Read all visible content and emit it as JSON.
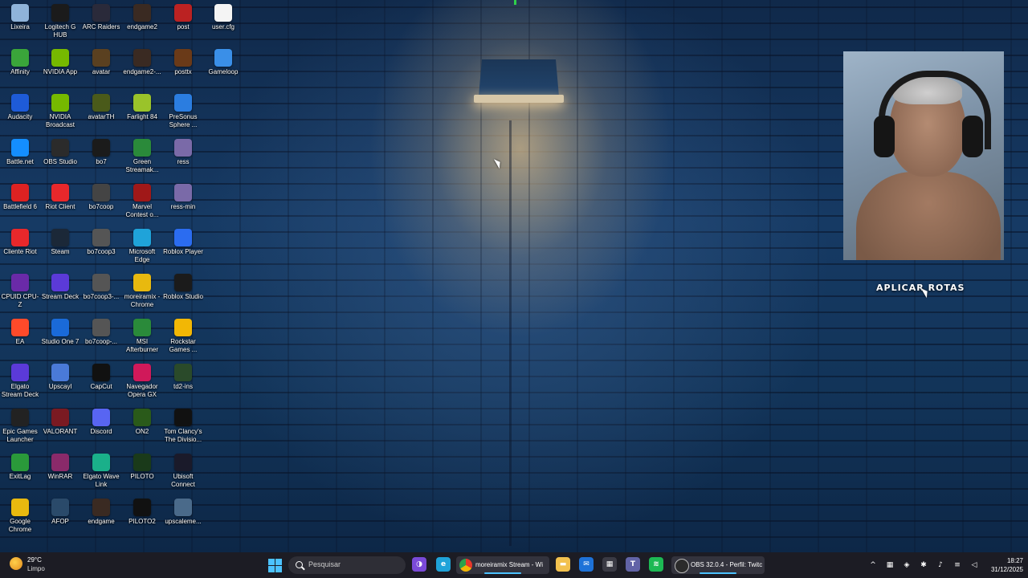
{
  "desktop_icons": [
    {
      "label": "Lixeira",
      "icon": "recycle-bin-icon",
      "color": "#8fb3d9"
    },
    {
      "label": "Logitech G HUB",
      "icon": "logitech-g-icon",
      "color": "#1b1b1b"
    },
    {
      "label": "ARC Raiders",
      "icon": "arc-raiders-icon",
      "color": "#2a2a3a"
    },
    {
      "label": "endgame2",
      "icon": "game-icon",
      "color": "#3a2a22"
    },
    {
      "label": "post",
      "icon": "game-icon",
      "color": "#b22"
    },
    {
      "label": "user.cfg",
      "icon": "file-icon",
      "color": "#f4f4f4"
    },
    {
      "label": "Affinity",
      "icon": "affinity-icon",
      "color": "#3aa53a"
    },
    {
      "label": "NVIDIA App",
      "icon": "nvidia-icon",
      "color": "#76b900"
    },
    {
      "label": "avatar",
      "icon": "game-icon",
      "color": "#5a4020"
    },
    {
      "label": "endgame2-...",
      "icon": "game-icon",
      "color": "#3a2a22"
    },
    {
      "label": "posttx",
      "icon": "game-icon",
      "color": "#6a3a18"
    },
    {
      "label": "Gameloop",
      "icon": "gameloop-icon",
      "color": "#3a8fe8"
    },
    {
      "label": "Audacity",
      "icon": "audacity-icon",
      "color": "#1e5bd8"
    },
    {
      "label": "NVIDIA Broadcast",
      "icon": "nvidia-icon",
      "color": "#76b900"
    },
    {
      "label": "avatarTH",
      "icon": "game-icon",
      "color": "#4a5a1a"
    },
    {
      "label": "Farlight 84",
      "icon": "farlight-icon",
      "color": "#9ac32a"
    },
    {
      "label": "PreSonus Sphere ...",
      "icon": "presonus-icon",
      "color": "#2b7de0"
    },
    {
      "label": "Battle.net",
      "icon": "battlenet-icon",
      "color": "#148eff"
    },
    {
      "label": "OBS Studio",
      "icon": "obs-icon",
      "color": "#2b2b2b"
    },
    {
      "label": "bo7",
      "icon": "game-icon",
      "color": "#1b1b1b"
    },
    {
      "label": "Green Streamak...",
      "icon": "streamak-icon",
      "color": "#2a8a3a"
    },
    {
      "label": "ress",
      "icon": "image-icon",
      "color": "#7a6aa8"
    },
    {
      "label": "Battlefield 6",
      "icon": "battlefield-icon",
      "color": "#d22"
    },
    {
      "label": "Riot Client",
      "icon": "riot-icon",
      "color": "#e8282b"
    },
    {
      "label": "bo7coop",
      "icon": "game-icon",
      "color": "#444"
    },
    {
      "label": "Marvel Contest o...",
      "icon": "marvel-icon",
      "color": "#a01818"
    },
    {
      "label": "ress-min",
      "icon": "image-icon",
      "color": "#7a6aa8"
    },
    {
      "label": "Cliente Riot",
      "icon": "riot-icon",
      "color": "#e8282b"
    },
    {
      "label": "Steam",
      "icon": "steam-icon",
      "color": "#1b2838"
    },
    {
      "label": "bo7coop3",
      "icon": "game-icon",
      "color": "#555"
    },
    {
      "label": "Microsoft Edge",
      "icon": "edge-icon",
      "color": "#1fa3d9"
    },
    {
      "label": "Roblox Player",
      "icon": "roblox-icon",
      "color": "#2b6cf0"
    },
    {
      "label": "CPUID CPU-Z",
      "icon": "cpuz-icon",
      "color": "#6a2aa8"
    },
    {
      "label": "Stream Deck",
      "icon": "streamdeck-icon",
      "color": "#5b3ad8"
    },
    {
      "label": "bo7coop3-...",
      "icon": "game-icon",
      "color": "#555"
    },
    {
      "label": "moreiramix - Chrome",
      "icon": "chrome-icon",
      "color": "#e8b90f"
    },
    {
      "label": "Roblox Studio",
      "icon": "roblox-icon",
      "color": "#1b1b1b"
    },
    {
      "label": "EA",
      "icon": "ea-icon",
      "color": "#ff4a2a"
    },
    {
      "label": "Studio One 7",
      "icon": "studio-one-icon",
      "color": "#1a6ad8"
    },
    {
      "label": "bo7coop-...",
      "icon": "game-icon",
      "color": "#555"
    },
    {
      "label": "MSI Afterburner",
      "icon": "msi-icon",
      "color": "#2a8a3a"
    },
    {
      "label": "Rockstar Games ...",
      "icon": "rockstar-icon",
      "color": "#f2b705"
    },
    {
      "label": "Elgato Stream Deck",
      "icon": "streamdeck-icon",
      "color": "#5b3ad8"
    },
    {
      "label": "Upscayl",
      "icon": "upscayl-icon",
      "color": "#4a7ad8"
    },
    {
      "label": "CapCut",
      "icon": "capcut-icon",
      "color": "#111"
    },
    {
      "label": "Navegador Opera GX",
      "icon": "opera-gx-icon",
      "color": "#d0195a"
    },
    {
      "label": "td2-ins",
      "icon": "game-icon",
      "color": "#2a4a2a"
    },
    {
      "label": "Epic Games Launcher",
      "icon": "epic-icon",
      "color": "#222"
    },
    {
      "label": "VALORANT",
      "icon": "valorant-icon",
      "color": "#7a1a22"
    },
    {
      "label": "Discord",
      "icon": "discord-icon",
      "color": "#5865f2"
    },
    {
      "label": "ON2",
      "icon": "game-icon",
      "color": "#2a5a1a"
    },
    {
      "label": "Tom Clancy's The Divisio...",
      "icon": "division-icon",
      "color": "#111"
    },
    {
      "label": "ExitLag",
      "icon": "exitlag-icon",
      "color": "#2a9a3a"
    },
    {
      "label": "WinRAR",
      "icon": "winrar-icon",
      "color": "#8a2a6a"
    },
    {
      "label": "Elgato Wave Link",
      "icon": "wavelink-icon",
      "color": "#1ab08a"
    },
    {
      "label": "PILOTO",
      "icon": "game-icon",
      "color": "#1a3a1a"
    },
    {
      "label": "Ubisoft Connect",
      "icon": "ubisoft-icon",
      "color": "#1a1a2a"
    },
    {
      "label": "Google Chrome",
      "icon": "chrome-icon",
      "color": "#e8b90f"
    },
    {
      "label": "AFOP",
      "icon": "afop-icon",
      "color": "#2a4a6a"
    },
    {
      "label": "endgame",
      "icon": "game-icon",
      "color": "#3a2a22"
    },
    {
      "label": "PILOTO2",
      "icon": "game-icon",
      "color": "#111"
    },
    {
      "label": "upscaleme...",
      "icon": "image-icon",
      "color": "#4a6a8a"
    }
  ],
  "overlay": {
    "aplicar_label": "APLICAR ROTAS"
  },
  "taskbar": {
    "weather": {
      "temp": "29°C",
      "desc": "Limpo"
    },
    "search_placeholder": "Pesquisar",
    "pinned": [
      {
        "icon": "copilot-icon",
        "color": "#7a4ad8",
        "glyph": "◑"
      },
      {
        "icon": "edge-icon",
        "color": "#1fa3d9",
        "glyph": "e"
      }
    ],
    "chrome_task": "moreiramix Stream - Wi",
    "pinned2": [
      {
        "icon": "file-explorer-icon",
        "color": "#f2c14e",
        "glyph": "▬"
      },
      {
        "icon": "outlook-icon",
        "color": "#1e72d8",
        "glyph": "✉"
      },
      {
        "icon": "store-icon",
        "color": "#3a3a44",
        "glyph": "▦"
      },
      {
        "icon": "teams-icon",
        "color": "#6264a7",
        "glyph": "T"
      },
      {
        "icon": "spotify-icon",
        "color": "#1db954",
        "glyph": "≋"
      }
    ],
    "obs_task": "OBS 32.0.4 - Perfil: Twitc",
    "tray": [
      {
        "icon": "chevron-up-icon",
        "glyph": "^"
      },
      {
        "icon": "stream-deck-tray-icon",
        "glyph": "▦"
      },
      {
        "icon": "security-tray-icon",
        "glyph": "◈"
      },
      {
        "icon": "settings-tray-icon",
        "glyph": "✱"
      },
      {
        "icon": "microphone-icon",
        "glyph": "♪"
      },
      {
        "icon": "network-icon",
        "glyph": "≡"
      },
      {
        "icon": "volume-icon",
        "glyph": "◁"
      }
    ],
    "clock": {
      "time": "18:27",
      "date": "31/12/2025"
    }
  }
}
